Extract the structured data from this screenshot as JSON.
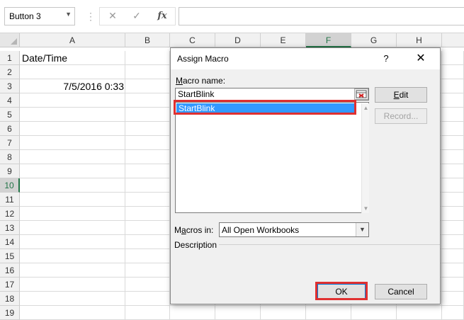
{
  "formula_bar": {
    "name_box": "Button 3",
    "cancel_glyph": "✕",
    "enter_glyph": "✓",
    "fx_label": "fx",
    "formula_value": ""
  },
  "sheet": {
    "columns": [
      "A",
      "B",
      "C",
      "D",
      "E",
      "F",
      "G",
      "H"
    ],
    "selected_column": "F",
    "rows": [
      "1",
      "2",
      "3",
      "4",
      "5",
      "6",
      "7",
      "8",
      "9",
      "10",
      "11",
      "12",
      "13",
      "14",
      "15",
      "16",
      "17",
      "18",
      "19"
    ],
    "selected_row": "10",
    "cells": {
      "A1": "Date/Time",
      "A3": "7/5/2016 0:33"
    }
  },
  "dialog": {
    "title": "Assign Macro",
    "help_label": "?",
    "close_label": "✕",
    "macro_name_label_u": "M",
    "macro_name_label_rest": "acro name:",
    "macro_name_value": "StartBlink",
    "macro_list": [
      "StartBlink"
    ],
    "edit_button_u": "E",
    "edit_button_rest": "dit",
    "record_button": "Record...",
    "macros_in_label_pre": "M",
    "macros_in_label_u": "a",
    "macros_in_label_rest": "cros in:",
    "macros_in_value": "All Open Workbooks",
    "description_label": "Description",
    "ok_button": "OK",
    "cancel_button": "Cancel",
    "highlight_color": "#e03030",
    "selection_color": "#3399ff"
  }
}
